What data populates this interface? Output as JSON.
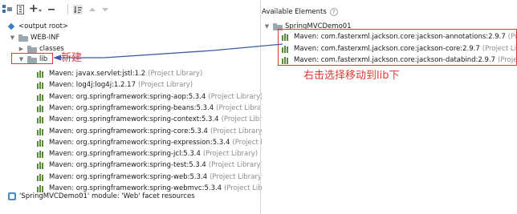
{
  "left": {
    "toolbar": {
      "buttons": [
        {
          "icon": "show-layout-icon"
        },
        {
          "icon": "archive-icon"
        },
        {
          "icon": "add-copy-icon"
        },
        {
          "icon": "remove-icon"
        },
        {
          "icon": "sort-icon"
        },
        {
          "icon": "move-up-icon"
        },
        {
          "icon": "move-down-icon"
        }
      ]
    },
    "tree": {
      "root": "<output root>",
      "web_inf": "WEB-INF",
      "classes": "classes",
      "lib": "lib",
      "libraries": [
        {
          "name": "Maven: javax.servlet:jstl:1.2",
          "suffix": "(Project Library)"
        },
        {
          "name": "Maven: log4j:log4j:1.2.17",
          "suffix": "(Project Library)"
        },
        {
          "name": "Maven: org.springframework:spring-aop:5.3.4",
          "suffix": "(Project Library)"
        },
        {
          "name": "Maven: org.springframework:spring-beans:5.3.4",
          "suffix": "(Project Library)"
        },
        {
          "name": "Maven: org.springframework:spring-context:5.3.4",
          "suffix": "(Project Library)"
        },
        {
          "name": "Maven: org.springframework:spring-core:5.3.4",
          "suffix": "(Project Library)"
        },
        {
          "name": "Maven: org.springframework:spring-expression:5.3.4",
          "suffix": "(Project Library)"
        },
        {
          "name": "Maven: org.springframework:spring-jcl:5.3.4",
          "suffix": "(Project Library)"
        },
        {
          "name": "Maven: org.springframework:spring-test:5.3.4",
          "suffix": "(Project Library)"
        },
        {
          "name": "Maven: org.springframework:spring-web:5.3.4",
          "suffix": "(Project Library)"
        },
        {
          "name": "Maven: org.springframework:spring-webmvc:5.3.4",
          "suffix": "(Project Libra"
        }
      ],
      "facet": "'SpringMVCDemo01' module: 'Web' facet resources"
    }
  },
  "right": {
    "header": "Available Elements",
    "module": "SpringMVCDemo01",
    "libraries": [
      {
        "name": "Maven: com.fasterxml.jackson.core:jackson-annotations:2.9.7",
        "suffix": "(Proje"
      },
      {
        "name": "Maven: com.fasterxml.jackson.core:jackson-core:2.9.7",
        "suffix": "(Project Lib"
      },
      {
        "name": "Maven: com.fasterxml.jackson.core:jackson-databind:2.9.7",
        "suffix": "(Projec"
      }
    ]
  },
  "annotations": {
    "new_label": "新建",
    "instruction": "右击选择移动到lib下",
    "color": "#e53935"
  }
}
